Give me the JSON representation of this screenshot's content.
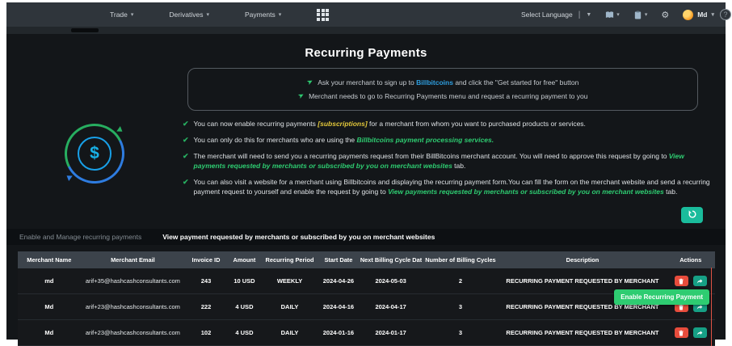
{
  "navbar": {
    "items": [
      {
        "label": "Trade"
      },
      {
        "label": "Derivatives"
      },
      {
        "label": "Payments"
      }
    ],
    "language_label": "Select Language",
    "user_name": "Md"
  },
  "page": {
    "title": "Recurring Payments",
    "instructions": [
      {
        "pre": "Ask your merchant to sign up to ",
        "link": "Billbitcoins",
        "post": " and click the \"Get started for free\" button"
      },
      {
        "pre": "Merchant needs to go to Recurring Payments menu and request a recurring payment to you",
        "link": "",
        "post": ""
      }
    ],
    "notes": [
      {
        "pre": "You can now enable recurring payments ",
        "highlight": "[subscriptions]",
        "post": " for a merchant from whom you want to purchased products or services."
      },
      {
        "pre": "You can only do this for merchants who are using the ",
        "highlight": "Billbitcoins payment processing services.",
        "post": ""
      },
      {
        "pre": "The merchant will need to send you a recurring payments request from their BillBitcoins merchant account. You will need to approve this request by going to ",
        "highlight": "View payments requested by merchants or subscribed by you on merchant websites",
        "post": " tab."
      },
      {
        "pre": "You can also visit a website for a merchant using Billbitcoins and displaying the recurring payment form.You can fill the form on the merchant website and send a recurring payment request to yourself and enable the request by going to ",
        "highlight": "View payments requested by merchants or subscribed by you on merchant websites",
        "post": " tab."
      }
    ]
  },
  "tabs": [
    {
      "label": "Enable and Manage recurring payments"
    },
    {
      "label": "View payment requested by merchants or subscribed by you on merchant websites"
    }
  ],
  "table": {
    "headers": [
      "Merchant Name",
      "Merchant Email",
      "Invoice ID",
      "Amount",
      "Recurring Period",
      "Start Date",
      "Next Billing Cycle Date",
      "Number of Billing Cycles",
      "Description",
      "Actions"
    ],
    "rows": [
      {
        "cells": [
          "md",
          "arif+35@hashcashconsultants.com",
          "243",
          "10 USD",
          "WEEKLY",
          "2024-04-26",
          "2024-05-03",
          "2",
          "RECURRING PAYMENT REQUESTED BY MERCHANT"
        ]
      },
      {
        "cells": [
          "Md",
          "arif+23@hashcashconsultants.com",
          "222",
          "4 USD",
          "DAILY",
          "2024-04-16",
          "2024-04-17",
          "3",
          "RECURRING PAYMENT REQUESTED BY MERCHANT"
        ]
      },
      {
        "cells": [
          "Md",
          "arif+23@hashcashconsultants.com",
          "102",
          "4 USD",
          "DAILY",
          "2024-01-16",
          "2024-01-17",
          "3",
          "RECURRING PAYMENT REQUESTED BY MERCHANT"
        ]
      }
    ]
  },
  "tooltip": {
    "text": "Enable Recurring Payment"
  },
  "colors": {
    "accent_teal": "#16a085",
    "refresh_green": "#1abc9c",
    "check_green": "#27ae60",
    "link_blue": "#2f9fe0",
    "danger_red": "#e74c3c",
    "tooltip_green": "#2ecc71",
    "highlight_yellow": "#e3c83b",
    "highlight_green": "#2ecc71"
  }
}
